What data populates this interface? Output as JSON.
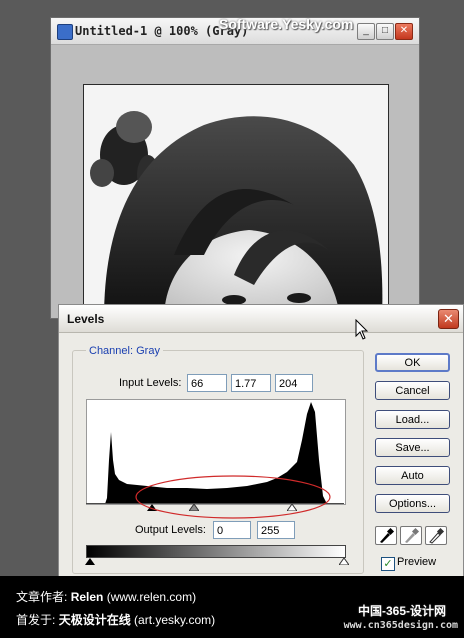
{
  "document_window": {
    "title": "Untitled-1 @ 100% (Gray)",
    "watermark": "Software.Yesky.com"
  },
  "levels_dialog": {
    "title": "Levels",
    "channel_label": "Channel:",
    "channel_value": "Gray",
    "input_levels_label": "Input Levels:",
    "input_black": "66",
    "input_gamma": "1.77",
    "input_white": "204",
    "output_levels_label": "Output Levels:",
    "output_black": "0",
    "output_white": "255",
    "buttons": {
      "ok": "OK",
      "cancel": "Cancel",
      "load": "Load...",
      "save": "Save...",
      "auto": "Auto",
      "options": "Options..."
    },
    "preview_label": "Preview",
    "preview_checked": true
  },
  "credits": {
    "author_label": "文章作者:",
    "author_name": "Relen",
    "author_site": "(www.relen.com)",
    "published_label": "首发于:",
    "published_site_name": "天极设计在线",
    "published_site_url": "(art.yesky.com)",
    "logo_cn": "中国-365-设计网",
    "logo_url": "www.cn365design.com"
  },
  "colors": {
    "accent": "#1a3fb0",
    "highlight_ellipse": "#d02a2a"
  }
}
